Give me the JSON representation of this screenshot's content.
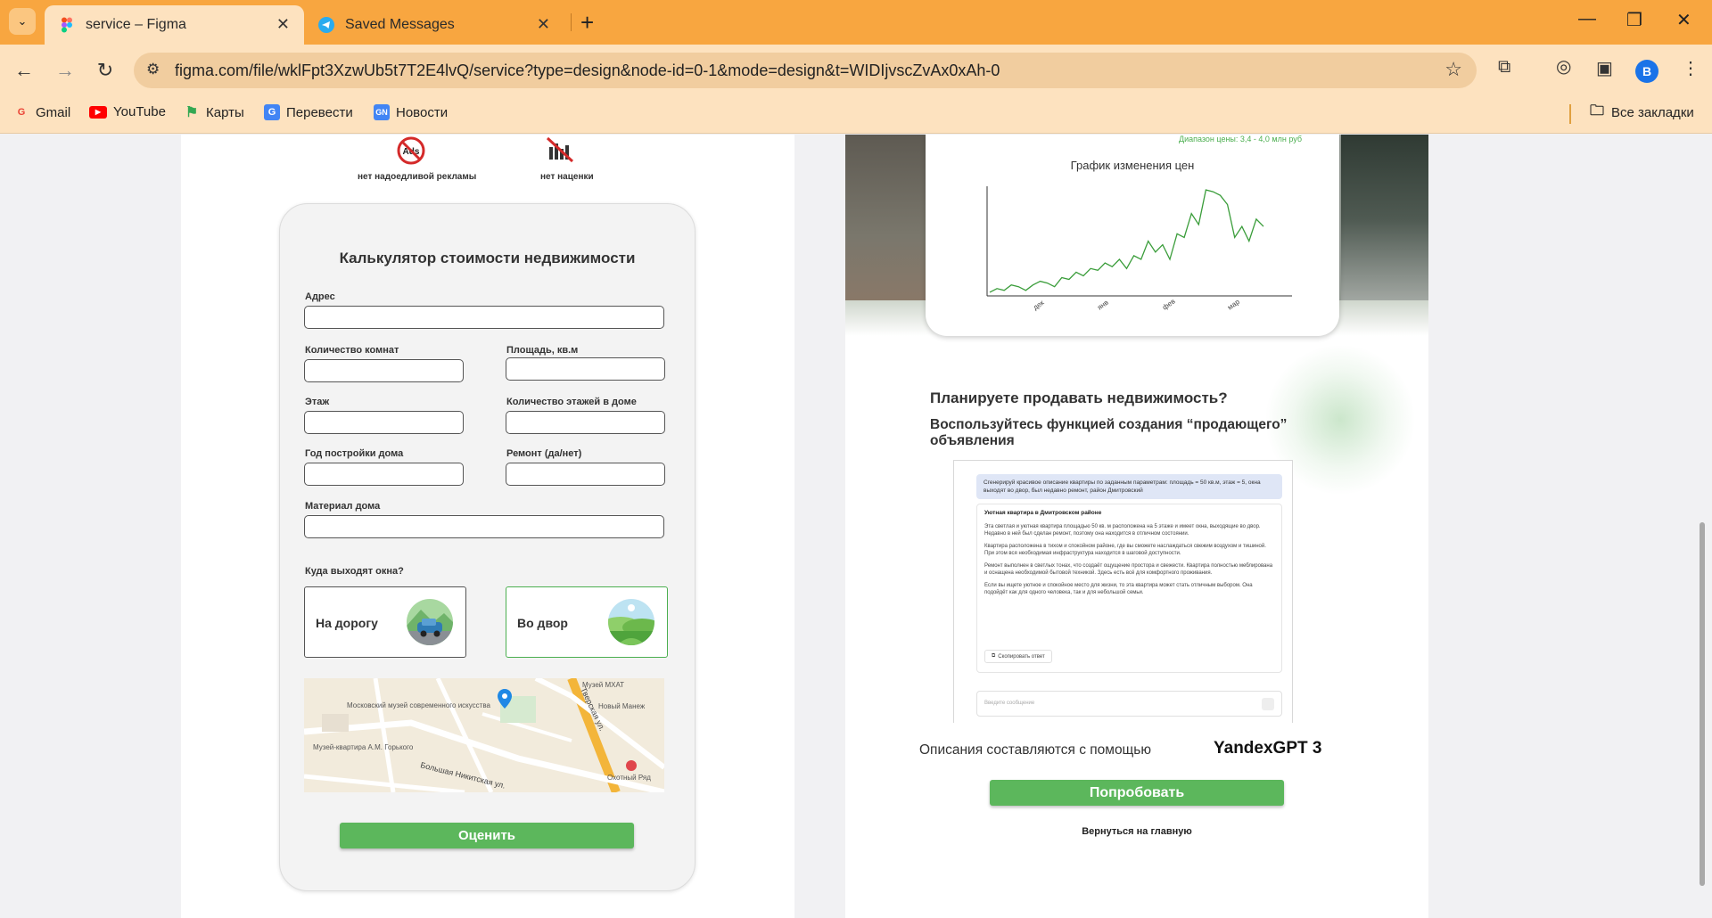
{
  "browser": {
    "tabs": [
      {
        "title": "service – Figma",
        "active": true,
        "icon": "figma-icon"
      },
      {
        "title": "Saved Messages",
        "active": false,
        "icon": "telegram-icon"
      }
    ],
    "url": "figma.com/file/wklFpt3XzwUb5t7T2E4lvQ/service?type=design&node-id=0-1&mode=design&t=WIDIjvscZvAx0xAh-0",
    "profile_initial": "B",
    "bookmarks": [
      {
        "label": "Gmail",
        "icon": "gmail-icon"
      },
      {
        "label": "YouTube",
        "icon": "youtube-icon"
      },
      {
        "label": "Карты",
        "icon": "maps-icon"
      },
      {
        "label": "Перевести",
        "icon": "translate-icon"
      },
      {
        "label": "Новости",
        "icon": "news-icon"
      }
    ],
    "all_bookmarks": "Все закладки"
  },
  "features": [
    {
      "label": "нет надоедливой рекламы",
      "icon": "no-ads-icon"
    },
    {
      "label": "нет наценки",
      "icon": "no-markup-icon"
    }
  ],
  "calculator": {
    "title": "Калькулятор стоимости недвижимости",
    "fields": {
      "address": "Адрес",
      "rooms": "Количество комнат",
      "area": "Площадь, кв.м",
      "floor": "Этаж",
      "floors_total": "Количество этажей в доме",
      "year": "Год постройки дома",
      "repair": "Ремонт (да/нет)",
      "material": "Материал дома"
    },
    "windows_question": "Куда выходят окна?",
    "window_options": [
      {
        "label": "На дорогу",
        "selected": false
      },
      {
        "label": "Во двор",
        "selected": true
      }
    ],
    "map_labels": {
      "museum_modern": "Московский музей современного искусства",
      "museum_gorky": "Музей-квартира А.М. Горького",
      "tverskaya": "Тверская ул.",
      "nikitskaya": "Большая Никитская ул.",
      "mhat": "Музей МХАТ",
      "manege": "Новый Манеж",
      "okhotny": "Охотный Ряд"
    },
    "submit": "Оценить"
  },
  "chart_data": {
    "type": "line",
    "title": "График изменения цен",
    "subtitle": "Диапазон цены: 3,4 - 4,0 млн руб",
    "x_ticks": [
      "дек",
      "янв",
      "фев",
      "мар"
    ],
    "series": [
      {
        "color": "#3a9d3a",
        "values": [
          3.42,
          3.44,
          3.43,
          3.46,
          3.45,
          3.43,
          3.46,
          3.48,
          3.47,
          3.45,
          3.5,
          3.49,
          3.53,
          3.51,
          3.55,
          3.54,
          3.58,
          3.56,
          3.6,
          3.55,
          3.62,
          3.6,
          3.7,
          3.64,
          3.68,
          3.6,
          3.74,
          3.72,
          3.85,
          3.79,
          3.98,
          3.97,
          3.95,
          3.9,
          3.72,
          3.78,
          3.7,
          3.82,
          3.78
        ]
      }
    ],
    "ylim": [
      3.4,
      4.0
    ],
    "grid": false
  },
  "promo": {
    "heading": "Планируете продавать недвижимость?",
    "subheading": "Воспользуйтесь функцией создания “продающего” объявления",
    "gpt_prompt": "Сгенерируй красивое описание квартиры по заданным параметрам: площадь = 50 кв.м, этаж = 5, окна выходят во двор, был недавно ремонт, район Дмитровский",
    "gpt_answer_title": "Уютная квартира в Дмитровском районе",
    "gpt_paragraphs": [
      "Эта светлая и уютная квартира площадью 50 кв. м расположена на 5 этаже и имеет окна, выходящие во двор. Недавно в ней был сделан ремонт, поэтому она находится в отличном состоянии.",
      "Квартира расположена в тихом и спокойном районе, где вы сможете наслаждаться свежим воздухом и тишиной. При этом вся необходимая инфраструктура находится в шаговой доступности.",
      "Ремонт выполнен в светлых тонах, что создаёт ощущение простора и свежести. Квартира полностью меблирована и оснащена необходимой бытовой техникой. Здесь есть всё для комфортного проживания.",
      "Если вы ищете уютное и спокойное место для жизни, то эта квартира может стать отличным выбором. Она подойдёт как для одного человека, так и для небольшой семьи."
    ],
    "copy_label": "Скопировать ответ",
    "input_placeholder": "Введите сообщение",
    "description_text": "Описания составляются с помощью",
    "brand": "YandexGPT 3",
    "try_button": "Попробовать",
    "back_link": "Вернуться на главную"
  }
}
